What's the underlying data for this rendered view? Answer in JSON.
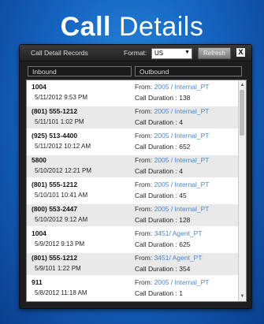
{
  "header": {
    "title_bold": "Call",
    "title_light": "Details"
  },
  "panel": {
    "title": "Call Detail Records",
    "format_label": "Format:",
    "format_value": "US",
    "refresh_label": "Refresh",
    "close_label": "X"
  },
  "tabs": {
    "inbound": "Inbound",
    "outbound": "Outbound"
  },
  "records": [
    {
      "number": "1004",
      "time": "5/11/2012 9:53 PM",
      "from_prefix": "From: ",
      "from_value": "2005 / Internal_PT",
      "duration": "Call Duration : 138"
    },
    {
      "number": "(801) 555-1212",
      "time": "5/11/101 1:02 PM",
      "from_prefix": "From: ",
      "from_value": "2005 / Internal_PT",
      "duration": "Call Duration : 4"
    },
    {
      "number": "(925) 513-4400",
      "time": "5/11/2012 10:12 AM",
      "from_prefix": "From: ",
      "from_value": "2005 / Internal_PT",
      "duration": "Call Duration : 652"
    },
    {
      "number": "5800",
      "time": "5/10/2012 12:21 PM",
      "from_prefix": "From: ",
      "from_value": "2005 / Internal_PT",
      "duration": "Call Duration : 4"
    },
    {
      "number": "(801) 555-1212",
      "time": "5/10/101 10:41 AM",
      "from_prefix": "From: ",
      "from_value": "2005 / Internal_PT",
      "duration": "Call Duration : 45"
    },
    {
      "number": "(800) 553-2447",
      "time": "5/10/2012 9:12 AM",
      "from_prefix": "From: ",
      "from_value": "2005 / Internal_PT",
      "duration": "Call Duration : 128"
    },
    {
      "number": "1004",
      "time": "5/9/2012 9:13 PM",
      "from_prefix": "From: ",
      "from_value": "3451/ Agent_PT",
      "duration": "Call Duration : 625"
    },
    {
      "number": "(801) 555-1212",
      "time": "5/9/101 1:22 PM",
      "from_prefix": "From: ",
      "from_value": "3451/ Agent_PT",
      "duration": "Call Duration : 354"
    },
    {
      "number": "911",
      "time": "5/8/2012 11:18 AM",
      "from_prefix": "From: ",
      "from_value": "2005 / Internal_PT",
      "duration": "Call Duration : 1"
    }
  ],
  "colors": {
    "link": "#4a86c8",
    "background": "#1667c4",
    "panel": "#1e1e1e"
  },
  "icons": {
    "scroll_up": "triangle-up-icon",
    "scroll_down": "triangle-down-icon",
    "close": "close-icon",
    "dropdown": "chevron-down-icon"
  }
}
